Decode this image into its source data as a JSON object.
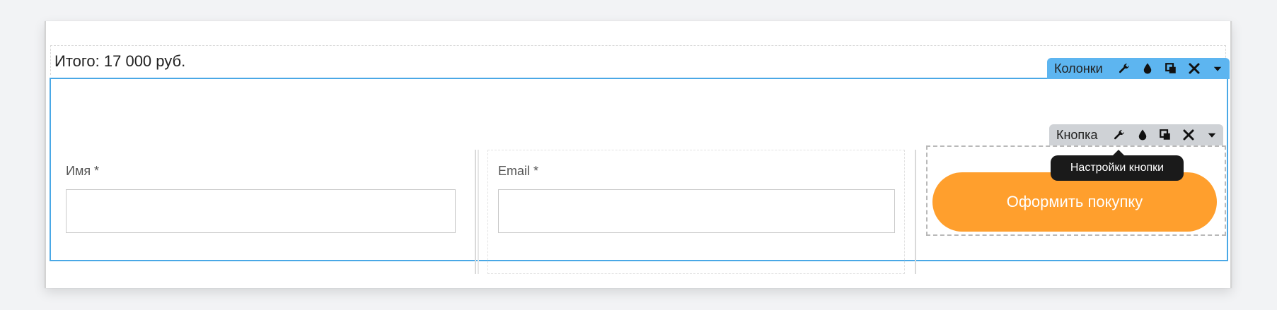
{
  "order": {
    "total_text": "Итого: 17 000 руб."
  },
  "columns_toolbar": {
    "label": "Колонки",
    "accent": "#5db5f0",
    "icons": [
      "wrench-icon",
      "drop-icon",
      "duplicate-icon",
      "close-icon",
      "caret-down-icon"
    ]
  },
  "button_toolbar": {
    "label": "Кнопка",
    "icons": [
      "wrench-icon",
      "drop-icon",
      "duplicate-icon",
      "close-icon",
      "caret-down-icon"
    ]
  },
  "tooltip": {
    "text": "Настройки кнопки"
  },
  "form": {
    "name": {
      "label": "Имя *",
      "value": ""
    },
    "email": {
      "label": "Email *",
      "value": ""
    },
    "submit": {
      "label": "Оформить покупку",
      "color": "#ff9f2d"
    }
  },
  "colors": {
    "selection_border": "#4aa8e6",
    "page_bg": "#f2f3f5"
  }
}
